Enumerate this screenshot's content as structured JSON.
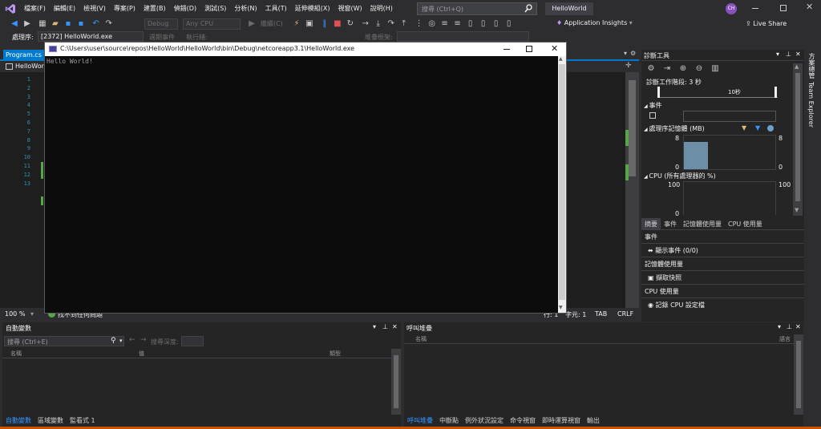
{
  "menu": [
    "檔案(F)",
    "編輯(E)",
    "檢視(V)",
    "專案(P)",
    "建置(B)",
    "偵錯(D)",
    "測試(S)",
    "分析(N)",
    "工具(T)",
    "延伸模組(X)",
    "視窗(W)",
    "說明(H)"
  ],
  "search": {
    "placeholder": "搜尋 (Ctrl+Q)"
  },
  "solution_name": "HelloWorld",
  "user_initials": "CH",
  "toolbar": {
    "config": "Debug",
    "platform": "Any CPU",
    "continue_label": "繼續(C)",
    "app_insights": "Application Insights",
    "live_share": "Live Share"
  },
  "process_bar": {
    "label": "處理序:",
    "process": "[2372] HelloWorld.exe",
    "lifecycle": "週期事件",
    "thread": "執行緒:",
    "stack": "堆疊框架:"
  },
  "editor": {
    "tab": "Program.cs",
    "nav": "HelloWorld",
    "line_numbers": [
      "1",
      "2",
      "3",
      "4",
      "5",
      "6",
      "7",
      "8",
      "9",
      "10",
      "11",
      "12",
      "13"
    ],
    "zoom": "100 %",
    "status": "找不到任何問題",
    "pos": "行: 1",
    "col": "字元: 1",
    "tab_mode": "TAB",
    "eol": "CRLF"
  },
  "console": {
    "title": "C:\\Users\\user\\source\\repos\\HelloWorld\\HelloWorld\\bin\\Debug\\netcoreapp3.1\\HelloWorld.exe",
    "output": "Hello World!"
  },
  "diag": {
    "title": "診斷工具",
    "session": "診斷工作階段: 3 秒",
    "timeline_tick": "10秒",
    "events": "事件",
    "memory": "處理序記憶體 (MB)",
    "mem_max": "8",
    "mem_min": "0",
    "mem_usage_fraction": 0.8,
    "cpu": "CPU (所有處理器的 %)",
    "cpu_max": "100",
    "cpu_min": "0",
    "tabs": [
      "摘要",
      "事件",
      "記憶體使用量",
      "CPU 使用量"
    ],
    "summary": {
      "events_head": "事件",
      "show_events": "顯示事件 (0/0)",
      "memory_head": "記憶體使用量",
      "snapshot": "擷取快照",
      "cpu_head": "CPU 使用量",
      "record_cpu": "記錄 CPU 設定檔"
    }
  },
  "side_tabs": [
    "方案總管",
    "Team Explorer"
  ],
  "autos": {
    "title": "自動變數",
    "search_placeholder": "搜尋 (Ctrl+E)",
    "depth_label": "搜尋深度:",
    "cols": [
      "名稱",
      "值",
      "類型"
    ],
    "tabs": [
      "自動變數",
      "區域變數",
      "監看式 1"
    ]
  },
  "callstack": {
    "title": "呼叫堆疊",
    "cols": [
      "名稱",
      "語言"
    ],
    "tabs": [
      "呼叫堆疊",
      "中斷點",
      "例外狀況設定",
      "命令視窗",
      "即時運算視窗",
      "輸出"
    ]
  },
  "colors": {
    "accent": "#007acc",
    "frame": "#2d2d30",
    "editor": "#1e1e1e",
    "console": "#0c0c0c",
    "memory_fill": "#6c8ea6",
    "tab_active": "#3794ff"
  }
}
